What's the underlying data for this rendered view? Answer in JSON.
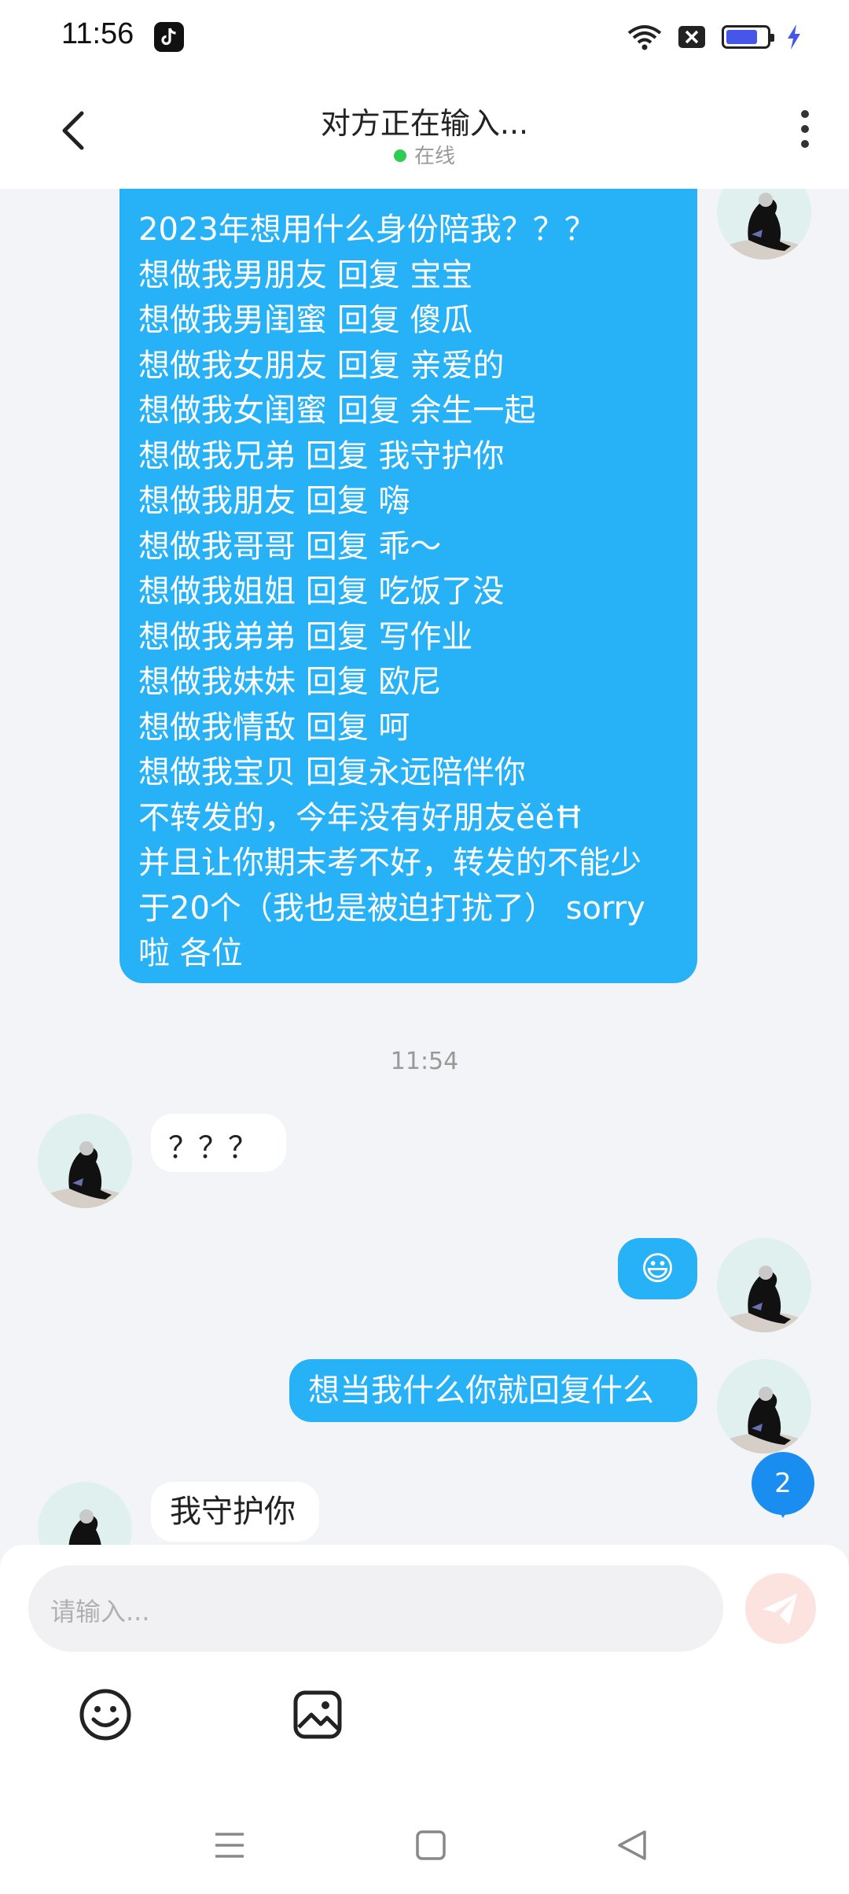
{
  "status_bar": {
    "time": "11:56",
    "app_icon": "tiktok-icon",
    "icons": [
      "wifi-icon",
      "sim-off-icon",
      "battery-icon",
      "charging-icon"
    ]
  },
  "header": {
    "title": "对方正在输入...",
    "status": "在线",
    "back_icon": "back-arrow-icon",
    "more_icon": "more-vertical-icon"
  },
  "messages": {
    "big_outgoing": {
      "lines": [
        "2023年想用什么身份陪我？？？",
        "想做我男朋友 回复 宝宝",
        "想做我男闺蜜 回复 傻瓜",
        "想做我女朋友 回复 亲爱的",
        "想做我女闺蜜 回复 余生一起",
        "想做我兄弟 回复 我守护你",
        "想做我朋友 回复 嗨",
        "想做我哥哥 回复 乖～",
        "想做我姐姐 回复 吃饭了没",
        "想做我弟弟 回复 写作业",
        "想做我妹妹 回复 欧尼",
        "想做我情敌 回复 呵",
        "想做我宝贝 回复永远陪伴你",
        "不转发的，今年没有好朋友ěěĦ",
        "并且让你期末考不好，转发的不能少",
        "于20个（我也是被迫打扰了） sorry",
        "啦 各位"
      ]
    },
    "timestamp": "11:54",
    "incoming_1": "？？？",
    "outgoing_emoji": "😃",
    "outgoing_2": "想当我什么你就回复什么",
    "incoming_2": "我守护你"
  },
  "unread_count": "2",
  "composer": {
    "placeholder": "请输入...",
    "send_icon": "send-icon",
    "tools": [
      "emoji-icon",
      "image-icon"
    ]
  },
  "system_nav": [
    "menu-icon",
    "home-icon",
    "back-icon"
  ],
  "colors": {
    "outgoing_bubble": "#27b1f6",
    "incoming_bubble": "#ffffff",
    "online_dot": "#2ecc55",
    "badge": "#1a8ef0",
    "send_disabled": "#fde3e0"
  }
}
